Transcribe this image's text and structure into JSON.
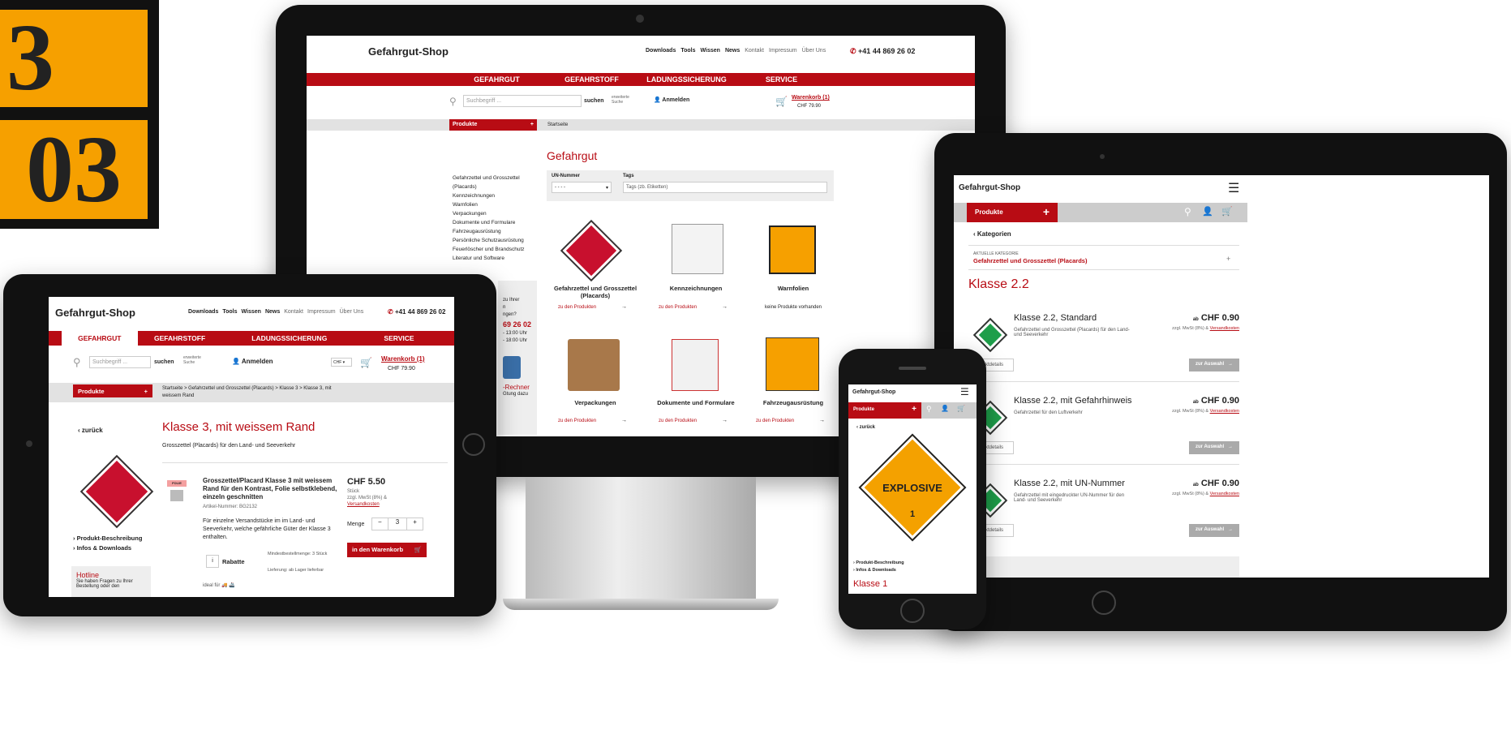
{
  "plate": {
    "top": "3",
    "bottom": "03"
  },
  "desk": {
    "logo": "Gefahrgut-Shop",
    "toplinks": [
      "Downloads",
      "Tools",
      "Wissen",
      "News",
      "Kontakt",
      "Impressum",
      "Über Uns"
    ],
    "phone": "+41 44 869 26 02",
    "nav": [
      "GEFAHRGUT",
      "GEFAHRSTOFF",
      "LADUNGSSICHERUNG",
      "SERVICE"
    ],
    "search_placeholder": "Suchbegriff ...",
    "search_btn": "suchen",
    "adv": "erweiterte Suche",
    "login": "Anmelden",
    "cart": "Warenkorb (1)",
    "cart_total": "CHF 79.90",
    "products": "Produkte",
    "breadcrumb": "Startseite",
    "title": "Gefahrgut",
    "filter_un": "UN-Nummer",
    "filter_un_val": "- - - -",
    "filter_tags": "Tags",
    "filter_tags_ph": "Tags (zb. Etiketten)",
    "sidebar": [
      "Gefahrzettel und Grosszettel (Placards)",
      "Kennzeichnungen",
      "Warnfolien",
      "Verpackungen",
      "Dokumente und Formulare",
      "Fahrzeugausrüstung",
      "Persönliche Schutzausrüstung",
      "Feuerlöscher und Brandschutz",
      "Literatur und Software"
    ],
    "side_partial": [
      "zu Ihrer",
      "n",
      "ngen?",
      "69 26 02",
      "- 13:00 Uhr",
      "- 18:00 Uhr",
      "-Rechner",
      "Gtung dazu"
    ],
    "cats": [
      {
        "name": "Gefahrzettel und Grosszettel (Placards)",
        "link": "zu den Produkten"
      },
      {
        "name": "Kennzeichnungen",
        "link": "zu den Produkten"
      },
      {
        "name": "Warnfolien",
        "link": "keine Produkte vorhanden"
      },
      {
        "name": "Verpackungen",
        "link": "zu den Produkten"
      },
      {
        "name": "Dokumente und Formulare",
        "link": "zu den Produkten"
      },
      {
        "name": "Fahrzeugausrüstung",
        "link": "zu den Produkten"
      }
    ],
    "arrow": "→"
  },
  "tabL": {
    "logo": "Gefahrgut-Shop",
    "toplinks": [
      "Downloads",
      "Tools",
      "Wissen",
      "News",
      "Kontakt",
      "Impressum",
      "Über Uns"
    ],
    "phone": "+41 44 869 26 02",
    "nav": [
      "GEFAHRGUT",
      "GEFAHRSTOFF",
      "LADUNGSSICHERUNG",
      "SERVICE"
    ],
    "search_ph": "Suchbegriff ...",
    "search_btn": "suchen",
    "adv": "erweiterte Suche",
    "login": "Anmelden",
    "currency": "CHF",
    "cart": "Warenkorb (1)",
    "cart_total": "CHF 79.90",
    "products": "Produkte",
    "breadcrumb": "Startseite  >  Gefahrzettel und Grosszettel (Placards)  >  Klasse 3  >  Klasse 3, mit weissem Rand",
    "back": "‹ zurück",
    "title": "Klasse 3, mit weissem Rand",
    "subtitle": "Grosszettel (Placards) für den Land- und Seeverkehr",
    "badge": "FOLIE",
    "prod_title": "Grosszettel/Placard Klasse 3 mit weissem Rand für den Kontrast, Folie selbstklebend, einzeln geschnitten",
    "art": "Artikel-Nummer: BG2132",
    "desc": "Für einzelne Versandstücke im im Land- und Seeverkehr, welche gefährliche Güter der Klasse 3 enthalten.",
    "price": "CHF 5.50",
    "unit": "Stück",
    "vat": "zzgl. MwSt (8%) &",
    "ship": "Versandkosten",
    "qty_label": "Menge",
    "qty": "3",
    "add": "in den Warenkorb",
    "rabatt": "Rabatte",
    "min": "Mindestbestellmenge: 3 Stück",
    "delivery": "Lieferung: ab Lager lieferbar",
    "ideal": "ideal für",
    "links": [
      "› Produkt-Beschreibung",
      "› Infos & Downloads"
    ],
    "hotline": "Hotline",
    "hotline_txt": "Sie haben Fragen zu Ihrer Bestellung oder den"
  },
  "tabR": {
    "logo": "Gefahrgut-Shop",
    "products": "Produkte",
    "back": "‹ Kategorien",
    "cur_label": "AKTUELLE KATEGORIE",
    "cur_cat": "Gefahrzettel und Grosszettel (Placards)",
    "title": "Klasse 2.2",
    "items": [
      {
        "name": "Klasse 2.2, Standard",
        "desc": "Gefahrzettel und Grosszettel (Placards) für den Land- und Seeverkehr"
      },
      {
        "name": "Klasse 2.2, mit Gefahrhinweis",
        "desc": "Gefahrzettel für den Luftverkehr"
      },
      {
        "name": "Klasse 2.2, mit UN-Nummer",
        "desc": "Gefahrzettel mit eingedruckter UN-Nummer für den Land- und Seeverkehr"
      }
    ],
    "ab": "ab",
    "price": "CHF 0.90",
    "vat": "zzgl. MwSt (8%) &",
    "ship": "Versandkosten",
    "details": "Produktdetails",
    "choose": "zur Auswahl"
  },
  "phone": {
    "logo": "Gefahrgut-Shop",
    "products": "Produkte",
    "back": "‹ zurück",
    "placard": "EXPLOSIVE",
    "placard_num": "1",
    "links": [
      "› Produkt-Beschreibung",
      "› Infos & Downloads"
    ],
    "title": "Klasse 1"
  }
}
